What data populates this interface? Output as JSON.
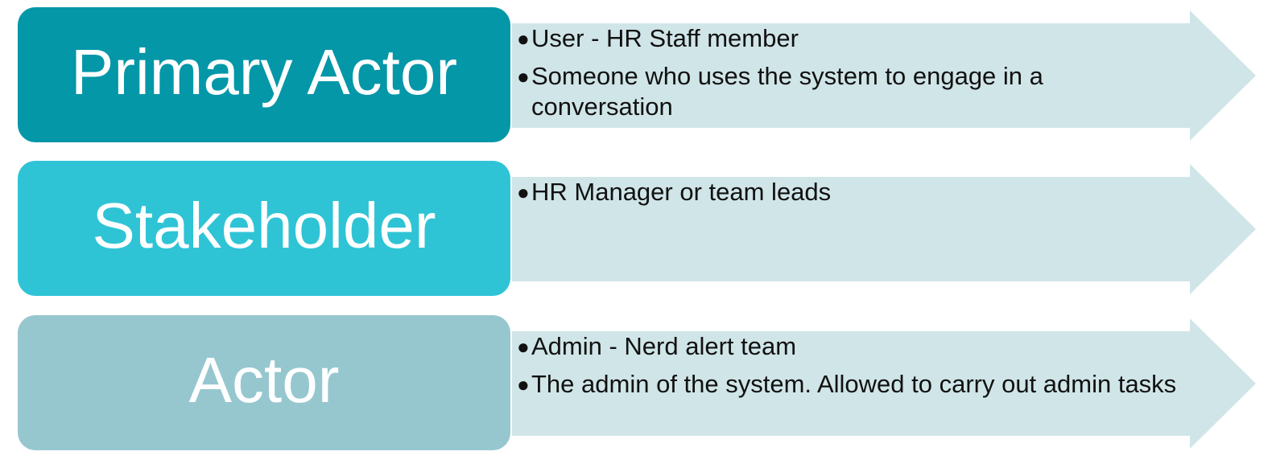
{
  "colors": {
    "primary_actor": "#0397a8",
    "stakeholder": "#2ec4d6",
    "actor": "#96c7cf",
    "arrow_fill": "#d0e5e8",
    "label_text": "#ffffff",
    "bullet_text": "#111111"
  },
  "rows": [
    {
      "label": "Primary Actor",
      "bullets": [
        "User - HR Staff member",
        "Someone who uses the system to engage in a conversation"
      ]
    },
    {
      "label": "Stakeholder",
      "bullets": [
        "HR Manager or team leads"
      ]
    },
    {
      "label": "Actor",
      "bullets": [
        "Admin - Nerd alert team",
        "The admin of the system. Allowed to carry out admin tasks"
      ]
    }
  ]
}
